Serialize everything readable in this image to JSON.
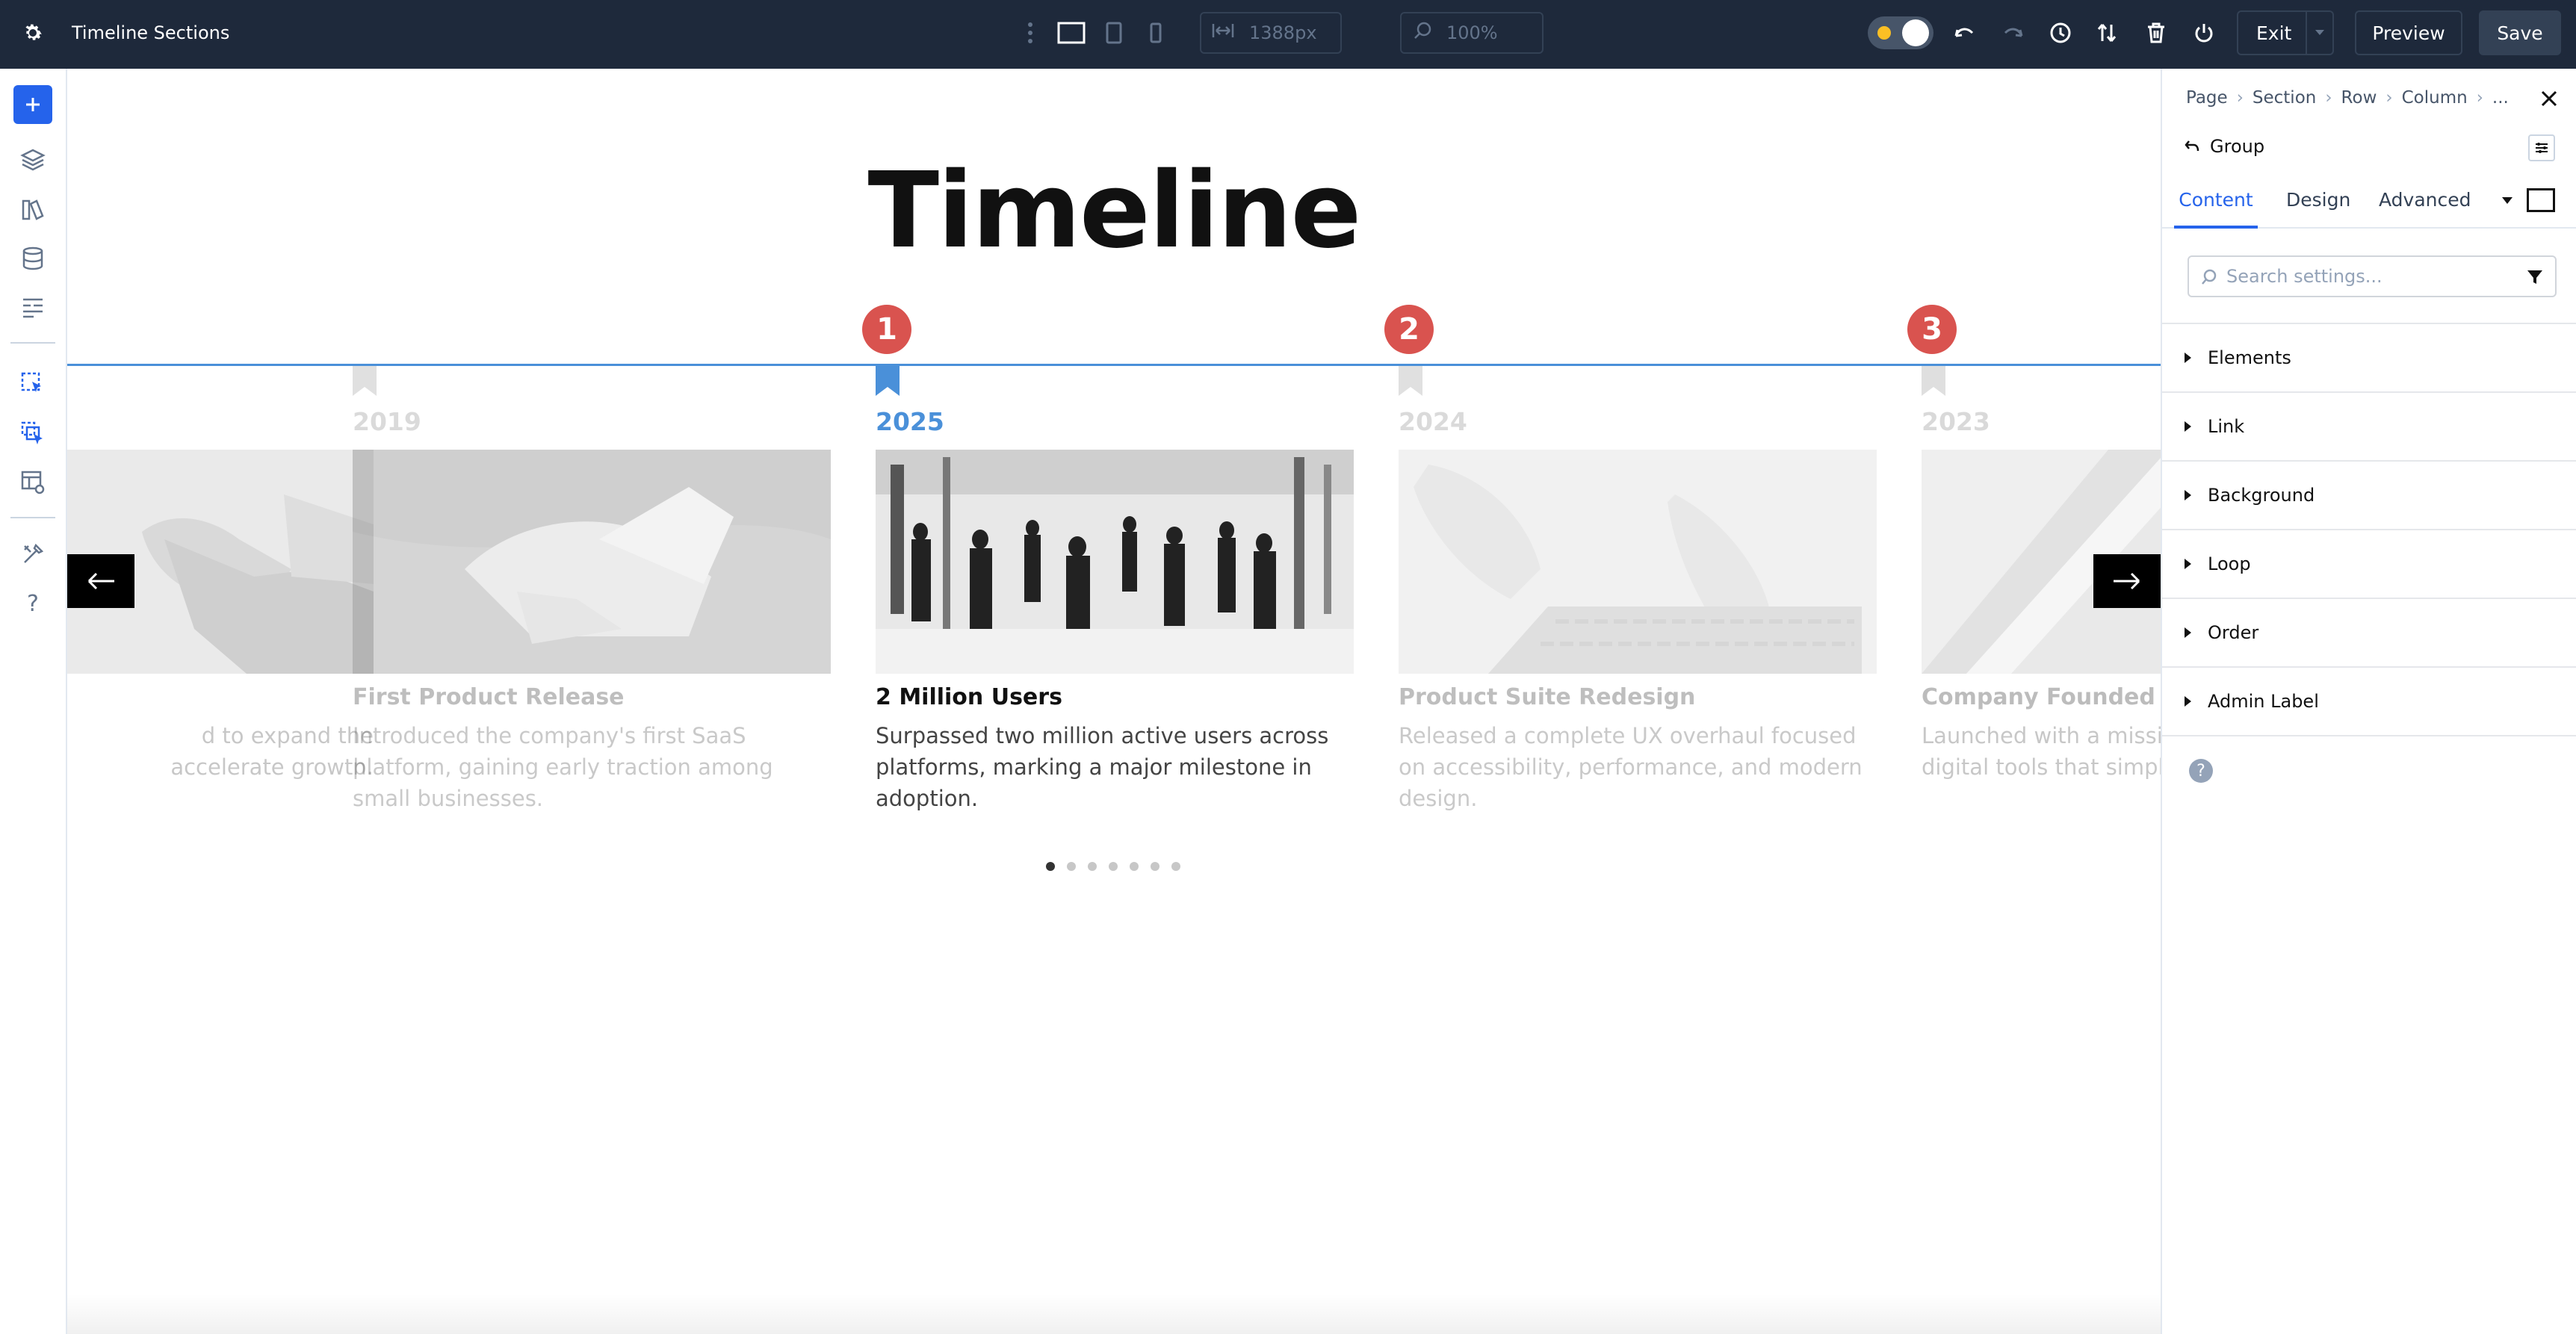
{
  "app": {
    "title": "Timeline Sections"
  },
  "toolbar": {
    "width_value": "1388px",
    "zoom_value": "100%",
    "exit_label": "Exit",
    "preview_label": "Preview",
    "save_label": "Save"
  },
  "canvas": {
    "heading": "Timeline",
    "markers": [
      "1",
      "2",
      "3"
    ],
    "cards": [
      {
        "year": "",
        "title": "",
        "desc": "d to expand the\naccelerate growth."
      },
      {
        "year": "2019",
        "title": "First Product Release",
        "desc": "Introduced the company's first SaaS platform, gaining early traction among small businesses."
      },
      {
        "year": "2025",
        "title": "2 Million Users",
        "desc": "Surpassed two million active users across platforms, marking a major milestone in adoption."
      },
      {
        "year": "2024",
        "title": "Product Suite Redesign",
        "desc": "Released a complete UX overhaul focused on accessibility, performance, and modern design."
      },
      {
        "year": "2023",
        "title": "Company Founded",
        "desc": "Launched with a mission to\ndigital tools that simplify"
      }
    ],
    "dots_count": 7,
    "active_dot": 0
  },
  "panel": {
    "breadcrumb": [
      "Page",
      "Section",
      "Row",
      "Column",
      "..."
    ],
    "group_label": "Group",
    "tabs": [
      "Content",
      "Design",
      "Advanced"
    ],
    "search_placeholder": "Search settings...",
    "sections": [
      "Elements",
      "Link",
      "Background",
      "Loop",
      "Order",
      "Admin Label"
    ]
  },
  "colors": {
    "accent": "#2563eb",
    "marker": "#d9534f",
    "timeline": "#4a90d9",
    "topbar": "#1e293b"
  }
}
